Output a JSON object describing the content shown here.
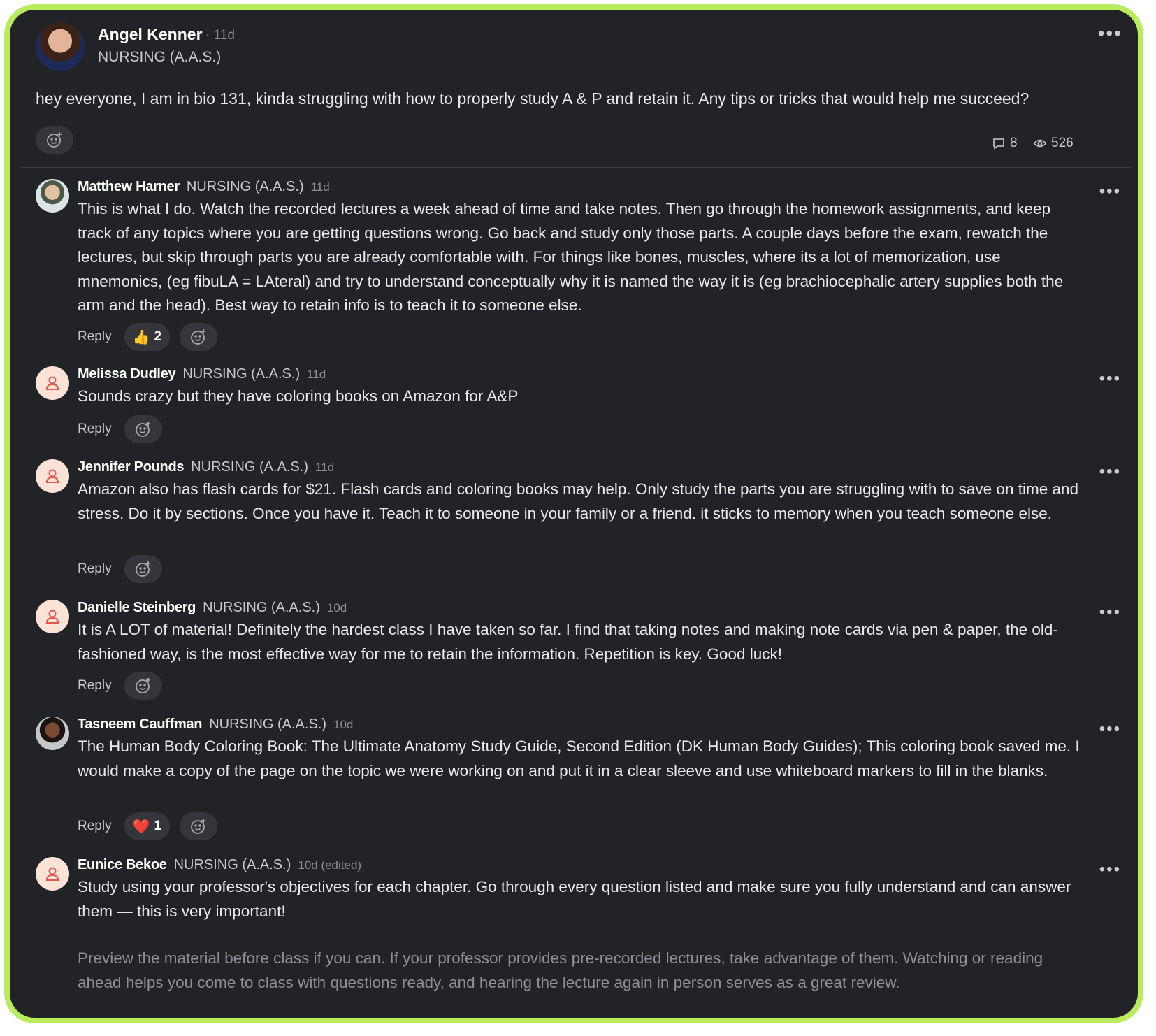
{
  "post": {
    "author": "Angel Kenner",
    "time": "· 11d",
    "tag": "NURSING (A.A.S.)",
    "menu": "•••",
    "body": "hey everyone, I am in bio 131, kinda struggling with how to properly study A & P and retain it. Any tips or tricks that would help me succeed?",
    "comment_count": "8",
    "view_count": "526"
  },
  "comments": [
    {
      "name": "Matthew Harner",
      "tag": "NURSING (A.A.S.)",
      "time": "11d",
      "body": "This is what I do. Watch the recorded lectures a week ahead of time and take notes. Then go through the homework assignments, and keep track of any topics where you are getting questions wrong. Go back and study only those parts. A couple days before the exam, rewatch the lectures, but skip through parts you are already comfortable with. For things like bones, muscles, where its a lot of memorization, use mnemonics, (eg fibuLA = LAteral) and try to understand conceptually why it is named the way it is (eg brachiocephalic artery supplies both the arm and the head). Best way to retain info is to teach it to someone else.",
      "reaction": {
        "emoji": "👍",
        "count": "2"
      }
    },
    {
      "name": "Melissa Dudley",
      "tag": "NURSING (A.A.S.)",
      "time": "11d",
      "body": "Sounds crazy but they have coloring books on Amazon for A&P"
    },
    {
      "name": "Jennifer Pounds",
      "tag": "NURSING (A.A.S.)",
      "time": "11d",
      "body": "Amazon also has flash cards for $21. Flash cards and coloring books may help. Only study the parts you are struggling with to save on time and stress. Do it by sections. Once you have it. Teach it to someone in your family or a friend. it sticks to memory when you teach someone else."
    },
    {
      "name": "Danielle Steinberg",
      "tag": "NURSING (A.A.S.)",
      "time": "10d",
      "body": "It is A LOT of material! Definitely the hardest class I have taken so far. I find that taking notes and making note cards via pen & paper, the old-fashioned way, is the most effective way for me to retain the information. Repetition is key. Good luck!"
    },
    {
      "name": "Tasneem Cauffman",
      "tag": "NURSING (A.A.S.)",
      "time": "10d",
      "body": "The Human Body Coloring Book: The Ultimate Anatomy Study Guide, Second Edition (DK Human Body Guides); This coloring book saved me. I would make a copy of the page on the topic we were working on and put it in a clear sleeve and use whiteboard markers to fill in the blanks.",
      "reaction": {
        "emoji": "❤️",
        "count": "1"
      }
    },
    {
      "name": "Eunice Bekoe",
      "tag": "NURSING (A.A.S.)",
      "time": "10d (edited)",
      "body": "Study using your professor's objectives for each chapter. Go through every question listed and make sure you fully understand and can answer them — this is very important!",
      "body2": "Preview the material before class if you can. If your professor provides pre-recorded lectures, take advantage of them. Watching or reading ahead helps you come to class with questions ready, and hearing the lecture again in person serves as a great review."
    }
  ],
  "labels": {
    "reply": "Reply",
    "menu": "•••"
  },
  "icons": {
    "add_reaction": "add-reaction-icon",
    "comments": "comment-icon",
    "views": "eye-icon",
    "default_avatar": "person-icon"
  },
  "colors": {
    "frame": "#b9ec5c",
    "background": "#222326",
    "text": "#e9eaec",
    "muted": "#8d8f95"
  }
}
